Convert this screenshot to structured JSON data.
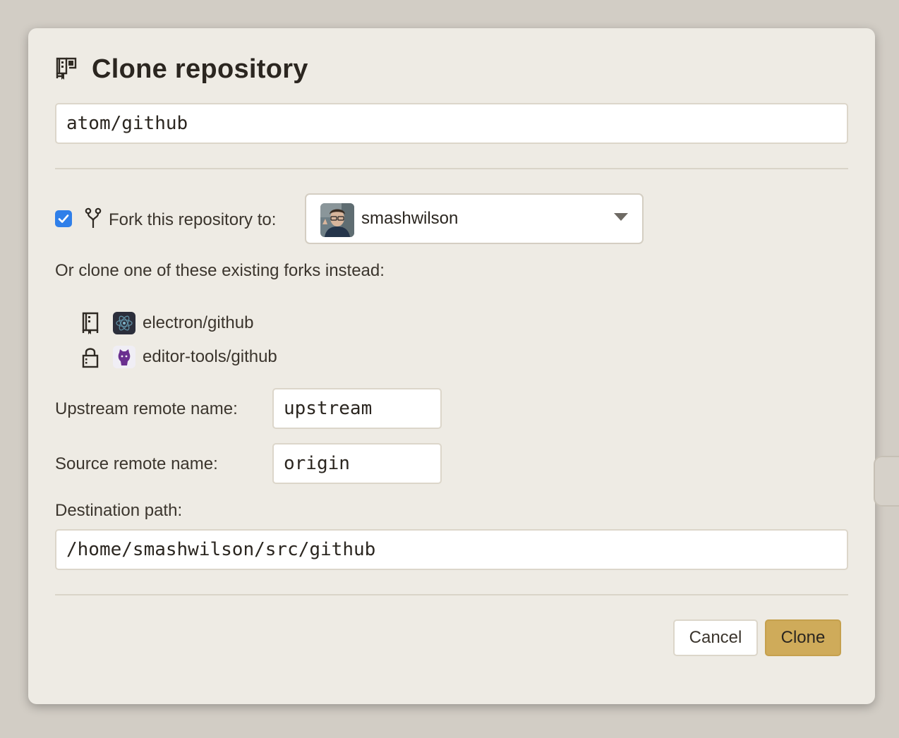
{
  "dialog": {
    "title": "Clone repository",
    "title_icon": "repo-clone-icon"
  },
  "repo_input": {
    "value": "atom/github"
  },
  "fork": {
    "checked": true,
    "icon": "repo-forked-icon",
    "label": "Fork this repository to:",
    "selected_owner": "smashwilson",
    "owner_avatar": "user-avatar",
    "dropdown_icon": "caret-down-icon"
  },
  "existing_forks": {
    "label": "Or clone one of these existing forks instead:",
    "items": [
      {
        "name": "electron/github",
        "kind_icon": "repo-icon",
        "avatar": "electron-avatar"
      },
      {
        "name": "editor-tools/github",
        "kind_icon": "lock-icon",
        "avatar": "octocat-avatar"
      }
    ]
  },
  "remotes": {
    "upstream_label": "Upstream remote name:",
    "upstream_value": "upstream",
    "source_label": "Source remote name:",
    "source_value": "origin"
  },
  "destination": {
    "label": "Destination path:",
    "value": "/home/smashwilson/src/github"
  },
  "buttons": {
    "cancel": "Cancel",
    "clone": "Clone"
  },
  "colors": {
    "background": "#d2cdc5",
    "dialog": "#eeebe4",
    "checkbox": "#2f7fe9",
    "primary_button": "#cfab5a"
  }
}
